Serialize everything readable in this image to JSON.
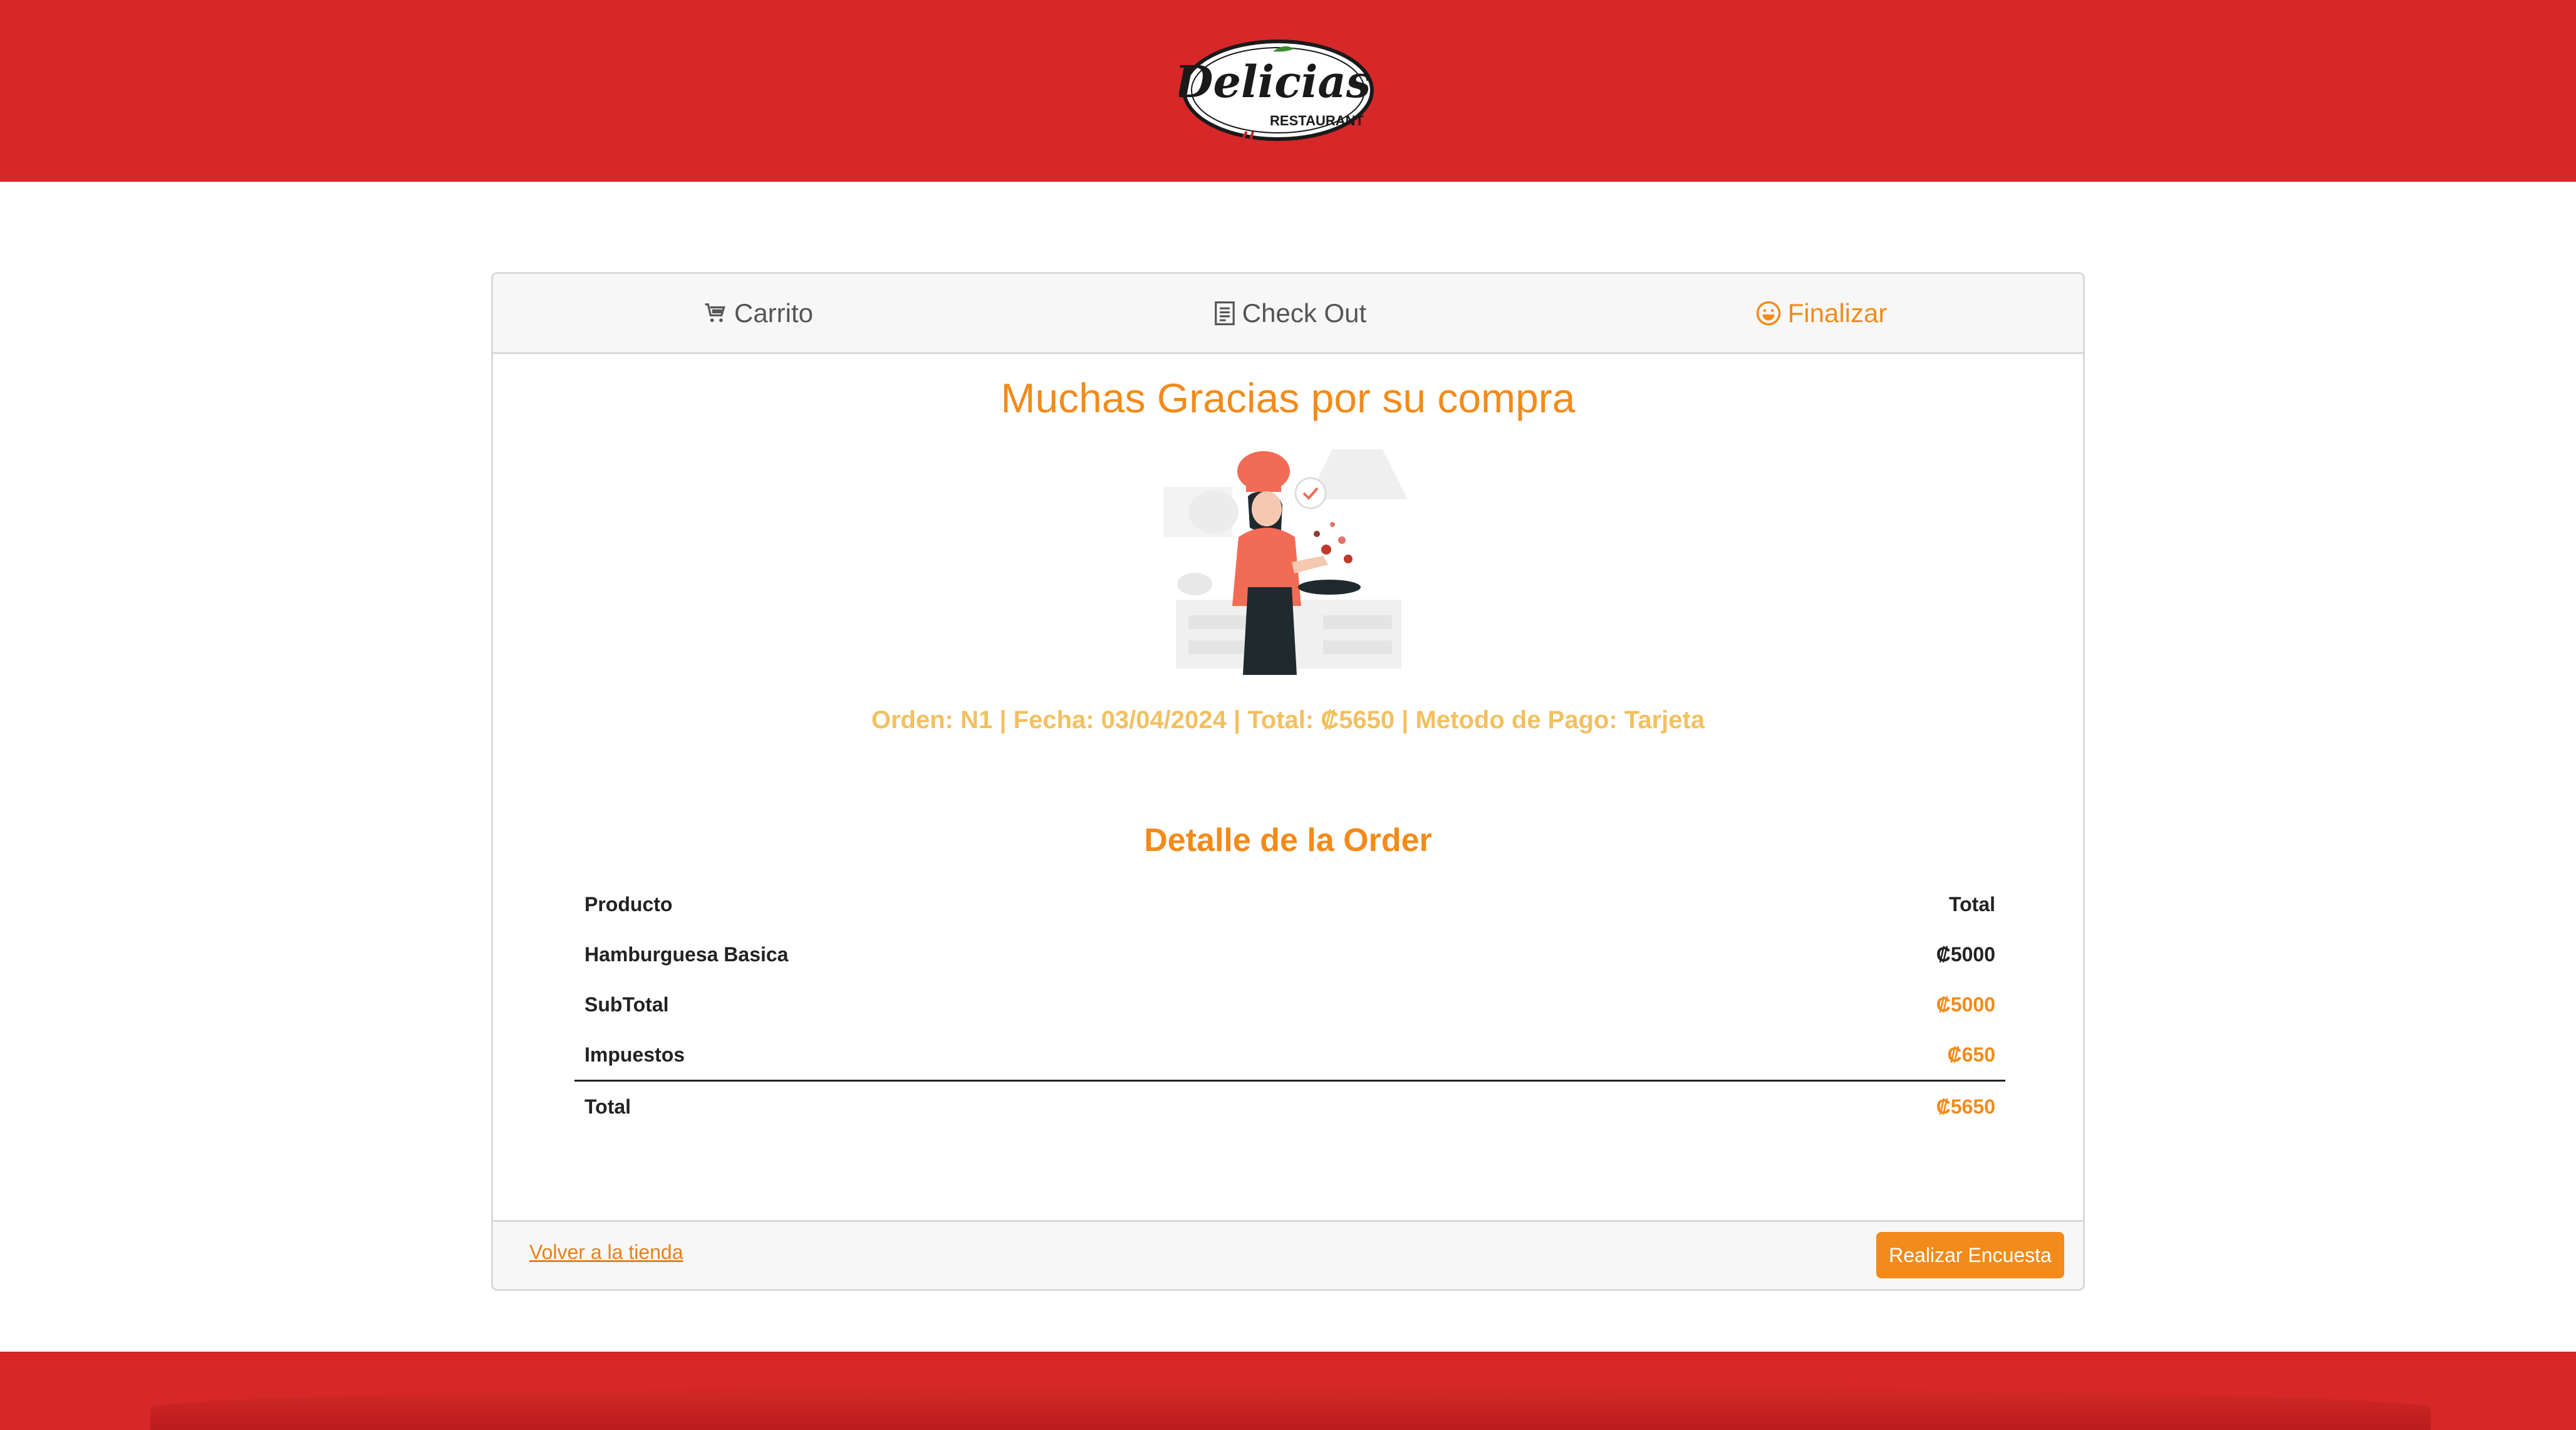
{
  "header": {
    "logo_text": "Delicias",
    "logo_sub": "RESTAURANT",
    "colors": {
      "brand_red": "#d62828"
    }
  },
  "steps": [
    {
      "label": "Carrito",
      "icon": "cart-icon",
      "active": false
    },
    {
      "label": "Check Out",
      "icon": "receipt-icon",
      "active": false
    },
    {
      "label": "Finalizar",
      "icon": "smile-icon",
      "active": true
    }
  ],
  "main": {
    "title": "Muchas Gracias por su compra",
    "illustration": "chef-cooking-illustration",
    "order_info": "Orden: N1 | Fecha: 03/04/2024 | Total: ₡5650 | Metodo de Pago: Tarjeta",
    "detail_title": "Detalle de la Order"
  },
  "table": {
    "headers": {
      "product": "Producto",
      "total": "Total"
    },
    "items": [
      {
        "product": "Hamburguesa Basica",
        "total": "₡5000"
      }
    ],
    "subtotal": {
      "label": "SubTotal",
      "value": "₡5000"
    },
    "taxes": {
      "label": "Impuestos",
      "value": "₡650"
    },
    "total": {
      "label": "Total",
      "value": "₡5650"
    }
  },
  "footer": {
    "back_link": "Volver a la tienda",
    "survey_button": "Realizar Encuesta"
  },
  "colors": {
    "accent": "#f28b1a",
    "order_info": "#f3c060"
  }
}
